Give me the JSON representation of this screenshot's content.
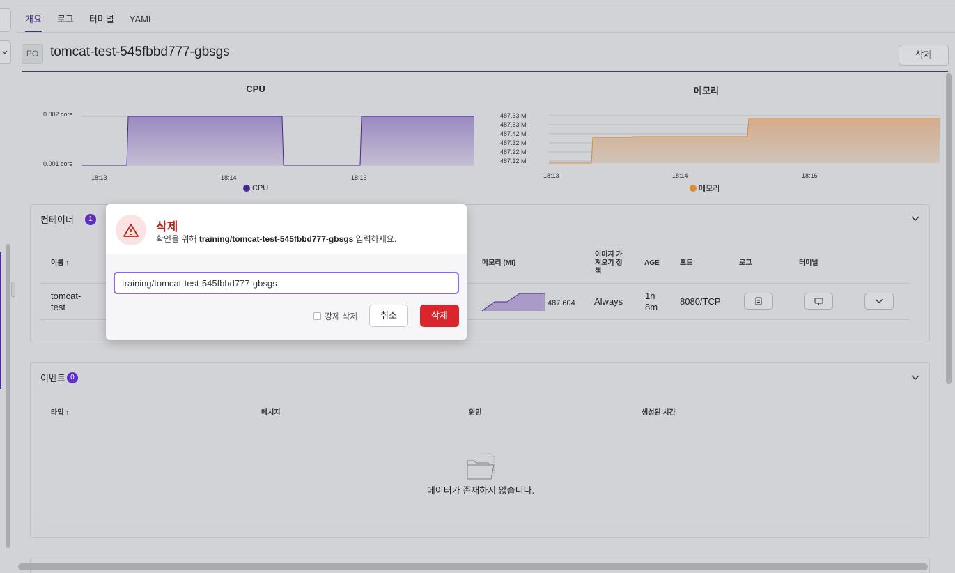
{
  "tabs": [
    {
      "label": "개요",
      "active": true
    },
    {
      "label": "로그",
      "active": false
    },
    {
      "label": "터미널",
      "active": false
    },
    {
      "label": "YAML",
      "active": false
    }
  ],
  "pod": {
    "kind_badge": "PO",
    "name": "tomcat-test-545fbbd777-gbsgs",
    "delete_label": "삭제"
  },
  "cpu_chart": {
    "title": "CPU",
    "legend": "CPU",
    "color": "#4a2b8f",
    "y_ticks": [
      "0.002 core",
      "0.001 core"
    ],
    "x_ticks": [
      "18:13",
      "18:14",
      "18:16"
    ]
  },
  "memory_chart": {
    "title": "메모리",
    "legend": "메모리",
    "color": "#e08a2c",
    "y_ticks": [
      "487.63 Mi",
      "487.53 Mi",
      "487.42 Mi",
      "487.32 Mi",
      "487.22 Mi",
      "487.12 Mi"
    ],
    "x_ticks": [
      "18:13",
      "18:14",
      "18:16"
    ]
  },
  "chart_data": [
    {
      "type": "area",
      "title": "CPU",
      "ylabel": "",
      "ylim": [
        0.001,
        0.002
      ],
      "x_ticks": [
        "18:13",
        "18:14",
        "18:16"
      ],
      "series": [
        {
          "name": "CPU",
          "points": [
            [
              "18:13",
              0.001
            ],
            [
              "18:13.5",
              0.001
            ],
            [
              "18:13.6",
              0.002
            ],
            [
              "18:14.5",
              0.002
            ],
            [
              "18:14.6",
              0.001
            ],
            [
              "18:15.5",
              0.001
            ],
            [
              "18:15.6",
              0.002
            ],
            [
              "18:16.9",
              0.002
            ]
          ]
        }
      ]
    },
    {
      "type": "area",
      "title": "메모리",
      "ylabel": "",
      "ylim": [
        487.12,
        487.63
      ],
      "x_ticks": [
        "18:13",
        "18:14",
        "18:16"
      ],
      "series": [
        {
          "name": "메모리",
          "points": [
            [
              "18:13",
              487.14
            ],
            [
              "18:13.3",
              487.14
            ],
            [
              "18:13.35",
              487.39
            ],
            [
              "18:13.6",
              487.39
            ],
            [
              "18:13.65",
              487.4
            ],
            [
              "18:14.5",
              487.4
            ],
            [
              "18:14.55",
              487.6
            ],
            [
              "18:16.9",
              487.6
            ]
          ]
        }
      ]
    }
  ],
  "containers": {
    "title": "컨테이너",
    "count": "1",
    "headers": {
      "name": "이름 ↑",
      "memory": "메모리 (MI)",
      "image_pull": "이미지 가\n져오기 정\n책",
      "age": "AGE",
      "port": "포트",
      "log": "로그",
      "terminal": "터미널"
    },
    "rows": [
      {
        "name": "tomcat-\ntest",
        "memory": "487.604",
        "image_pull": "Always",
        "age": "1h\n8m",
        "port": "8080/TCP"
      }
    ]
  },
  "events": {
    "title": "이벤트",
    "count": "0",
    "headers": {
      "type": "타입 ↑",
      "message": "메시지",
      "reason": "원인",
      "created": "생성된 시간"
    },
    "empty": "데이터가 존재하지 않습니다."
  },
  "modal": {
    "title": "삭제",
    "sub_prefix": "확인을 위해 ",
    "sub_target": "training/tomcat-test-545fbbd777-gbsgs",
    "sub_suffix": " 입력하세요.",
    "input_value": "training/tomcat-test-545fbbd777-gbsgs",
    "force_label": "강제 삭제",
    "cancel_label": "취소",
    "confirm_label": "삭제",
    "accent_color": "#d9252b"
  }
}
